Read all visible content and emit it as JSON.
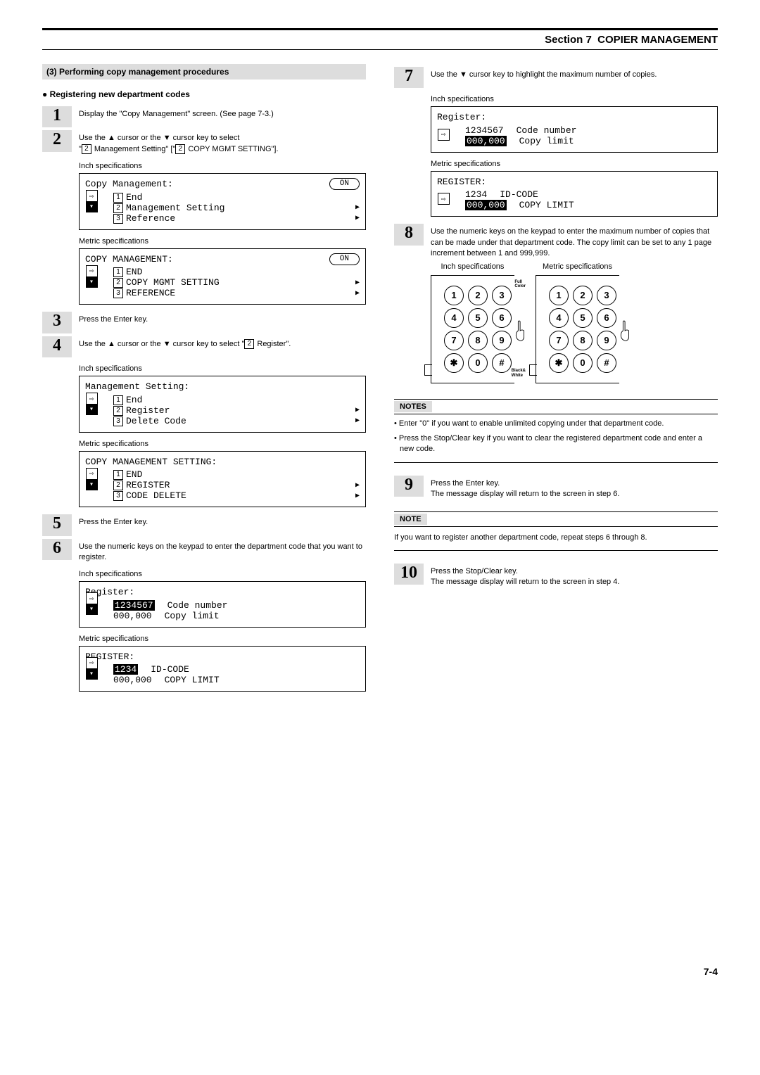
{
  "header": {
    "section": "Section 7",
    "title": "COPIER MANAGEMENT"
  },
  "left": {
    "bar": "(3)  Performing copy management procedures",
    "subhead": "Registering new department codes",
    "s1": "Display the \"Copy Management\" screen. (See page 7-3.)",
    "s2": "Use the ▲ cursor or the ▼ cursor key to select \"2 Management Setting\" [\"2 COPY MGMT SETTING\"].",
    "inch": "Inch specifications",
    "metric": "Metric specifications",
    "lcd1": {
      "title": "Copy Management:",
      "on": "ON",
      "i1": "End",
      "i2": "Management Setting",
      "i3": "Reference"
    },
    "lcd1m": {
      "title": "COPY MANAGEMENT:",
      "on": "ON",
      "i1": "END",
      "i2": "COPY MGMT SETTING",
      "i3": "REFERENCE"
    },
    "s3": "Press the Enter key.",
    "s4": "Use the ▲ cursor or the ▼ cursor key to select \"2 Register\".",
    "lcd2": {
      "title": "Management Setting:",
      "i1": "End",
      "i2": "Register",
      "i3": "Delete Code"
    },
    "lcd2m": {
      "title": "COPY MANAGEMENT SETTING:",
      "i1": "END",
      "i2": "REGISTER",
      "i3": "CODE DELETE"
    },
    "s5": "Press the Enter key.",
    "s6": "Use the numeric keys on the keypad to enter the department code that you want to register.",
    "lcd3": {
      "title": "Register:",
      "code": "1234567",
      "codeLbl": "Code number",
      "limit": "000,000",
      "limitLbl": "Copy limit"
    },
    "lcd3m": {
      "title": "REGISTER:",
      "code": "1234",
      "codeLbl": "ID-CODE",
      "limit": "000,000",
      "limitLbl": "COPY LIMIT"
    }
  },
  "right": {
    "s7": "Use the ▼ cursor key to highlight the maximum number of copies.",
    "lcd7": {
      "title": "Register:",
      "code": "1234567",
      "codeLbl": "Code number",
      "limit": "000,000",
      "limitLbl": "Copy limit"
    },
    "lcd7m": {
      "title": "REGISTER:",
      "code": "1234",
      "codeLbl": "ID-CODE",
      "limit": "000,000",
      "limitLbl": "COPY LIMIT"
    },
    "s8": "Use the numeric keys on the keypad to enter the maximum number of copies that can be made under that department code. The copy limit can be set to any 1 page increment between 1 and 999,999.",
    "kpFull": "Full Color",
    "kpBW": "Black& White",
    "notesHdr": "NOTES",
    "note1": "Enter \"0\" if you want to enable unlimited copying under that department code.",
    "note2": "Press the Stop/Clear key if you want to clear the registered department code and enter a new code.",
    "s9a": "Press the Enter key.",
    "s9b": "The message display will return to the screen in step 6.",
    "noteHdr": "NOTE",
    "noteRepeat": "If you want to register another department code, repeat steps 6 through 8.",
    "s10a": "Press the Stop/Clear key.",
    "s10b": "The message display will return to the screen in step 4."
  },
  "footer": "7-4"
}
